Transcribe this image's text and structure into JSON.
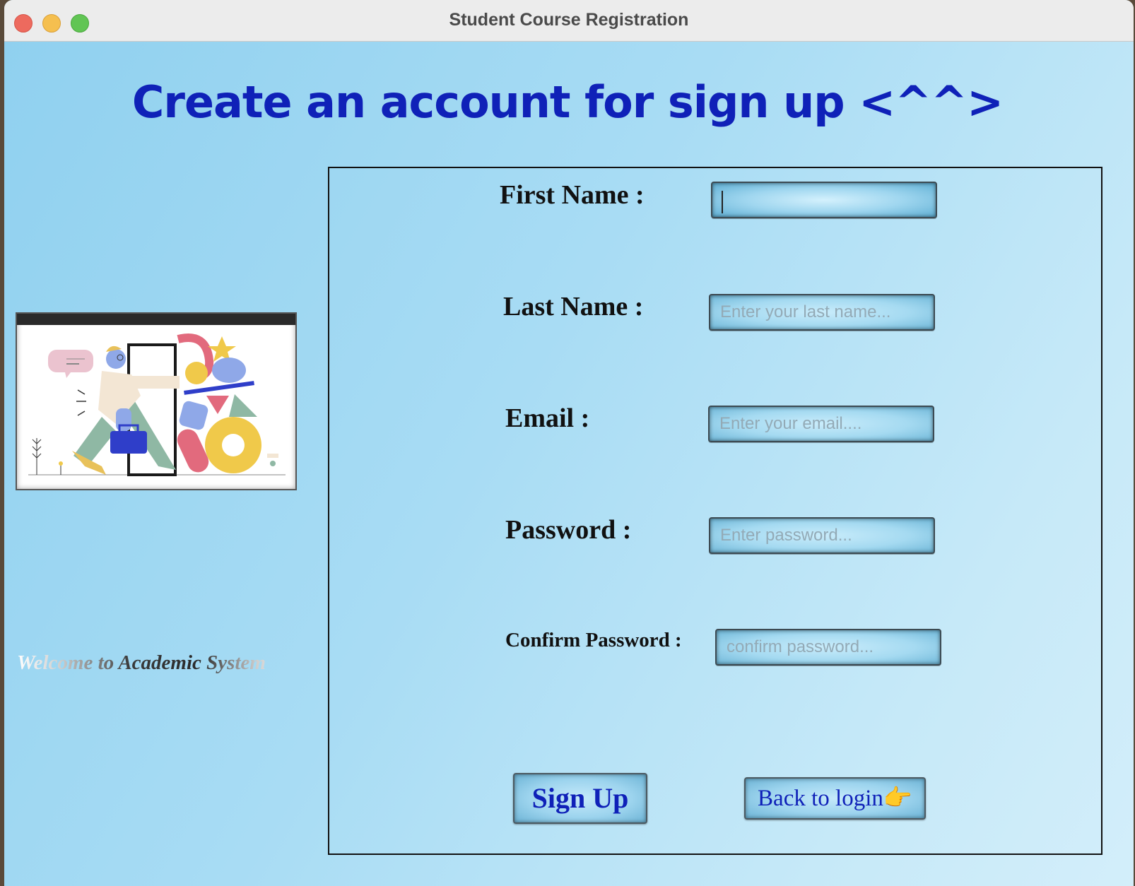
{
  "window": {
    "title": "Student Course Registration"
  },
  "page": {
    "heading": "Create an account for sign up <^^>",
    "welcome_text": "Welcome to Academic System"
  },
  "form": {
    "first_name": {
      "label": "First Name :",
      "value": "",
      "placeholder": ""
    },
    "last_name": {
      "label": "Last Name :",
      "value": "",
      "placeholder": "Enter your last name..."
    },
    "email": {
      "label": "Email :",
      "value": "",
      "placeholder": "Enter your email...."
    },
    "password": {
      "label": "Password :",
      "value": "",
      "placeholder": "Enter password..."
    },
    "confirm_password": {
      "label": "Confirm Password :",
      "value": "",
      "placeholder": "confirm password..."
    }
  },
  "buttons": {
    "signup_label": "Sign Up",
    "back_label": "Back to login👉"
  },
  "colors": {
    "accent": "#0f21b8",
    "background": "#a8dcf4"
  }
}
